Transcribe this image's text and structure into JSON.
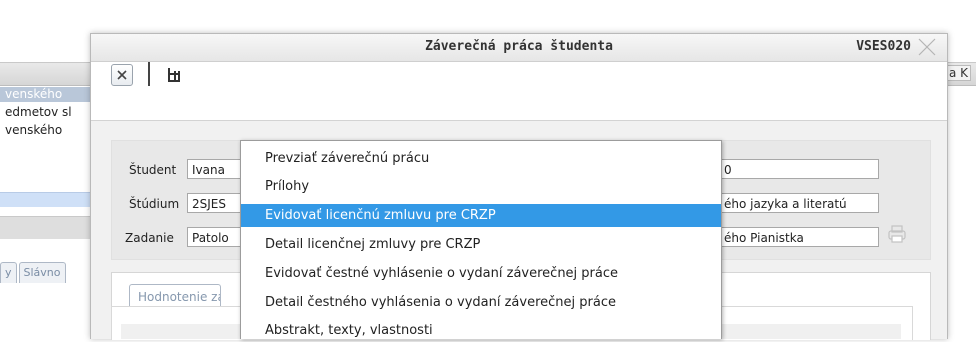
{
  "background": {
    "left_tab": "venského",
    "left_lines": [
      "edmetov sl",
      "venského"
    ],
    "left_tabs": [
      "y",
      "Slávno"
    ],
    "right_strip": "a K"
  },
  "dialog": {
    "title": "Záverečná práca študenta",
    "code": "VSES020",
    "form": {
      "student_label": "Študent",
      "student_value": "Ivana",
      "student_right_value": "0",
      "study_label": "Štúdium",
      "study_value": "2SJES",
      "study_right_value": "ého jazyka a literatú",
      "assignment_label": "Zadanie",
      "assignment_value": "Patolo",
      "assignment_right_value": "ého Pianistka"
    },
    "lower_tab": "Hodnotenie zá"
  },
  "menu": {
    "items": [
      {
        "label": "Prevziať záverečnú prácu",
        "active": false
      },
      {
        "label": "Prílohy",
        "active": false
      },
      {
        "label": "Evidovať licenčnú zmluvu pre CRZP",
        "active": true
      },
      {
        "label": "Detail licenčnej zmluvy pre CRZP",
        "active": false
      },
      {
        "label": "Evidovať čestné vyhlásenie o vydaní záverečnej práce",
        "active": false
      },
      {
        "label": "Detail čestného vyhlásenia o vydaní záverečnej práce",
        "active": false
      },
      {
        "label": "Abstrakt, texty, vlastnosti",
        "active": false
      }
    ]
  },
  "colors": {
    "menu_highlight": "#3399e6",
    "tab_text": "#8698ae"
  }
}
